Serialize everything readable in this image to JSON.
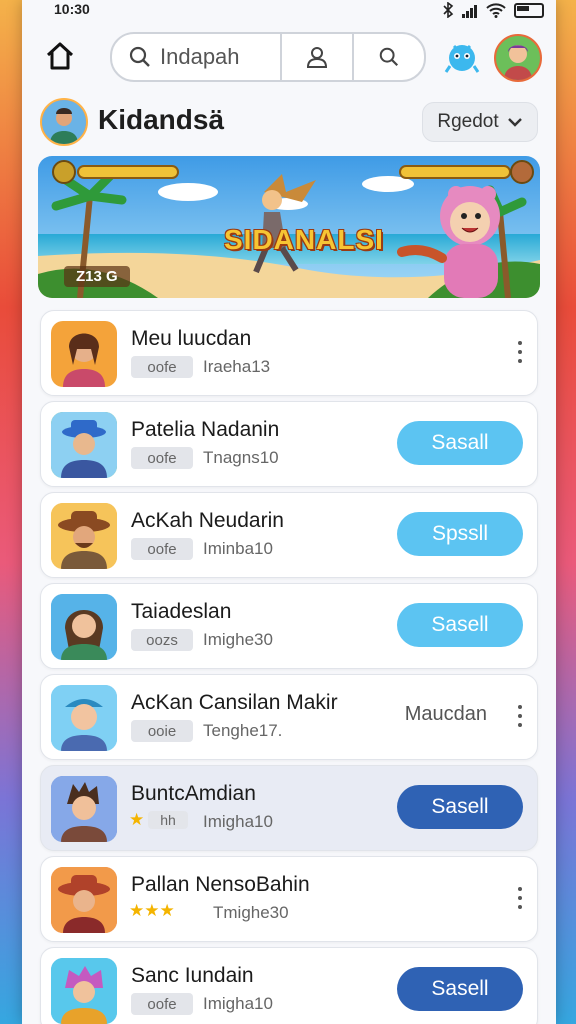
{
  "status": {
    "time": "10:30"
  },
  "search": {
    "placeholder": "Indapah"
  },
  "profile": {
    "name": "Kidandsä",
    "menu_label": "Rgedot"
  },
  "banner": {
    "title": "SIDANALSI",
    "score": "Z13 G"
  },
  "colors": {
    "accent_light": "#5cc4f2",
    "accent_dark": "#2f62b4"
  },
  "games": [
    {
      "title": "Meu luucdan",
      "tag": "oofe",
      "meta": "Iraeha13",
      "action": "menu"
    },
    {
      "title": "Patelia Nadanin",
      "tag": "oofe",
      "meta": "Tnagns10",
      "action": "button",
      "button": "Sasall"
    },
    {
      "title": "AcKah Neudarin",
      "tag": "oofe",
      "meta": "Iminba10",
      "action": "button",
      "button": "Spssll"
    },
    {
      "title": "Taiadeslan",
      "tag": "oozs",
      "meta": "Imighe30",
      "action": "button",
      "button": "Sasell"
    },
    {
      "title": "AcKan Cansilan Makir",
      "tag": "ooie",
      "meta": "Tenghe17.",
      "action": "text",
      "text": "Maucdan"
    },
    {
      "title": "BuntcAmdian",
      "tag": "hh",
      "meta": "Imigha10",
      "action": "button",
      "button": "Sasell",
      "rating": 1
    },
    {
      "title": "Pallan NensoBahin",
      "tag": "",
      "meta": "Tmighe30",
      "action": "menu",
      "rating": 3
    },
    {
      "title": "Sanc Iundain",
      "tag": "oofe",
      "meta": "Imigha10",
      "action": "button",
      "button": "Sasell"
    }
  ]
}
